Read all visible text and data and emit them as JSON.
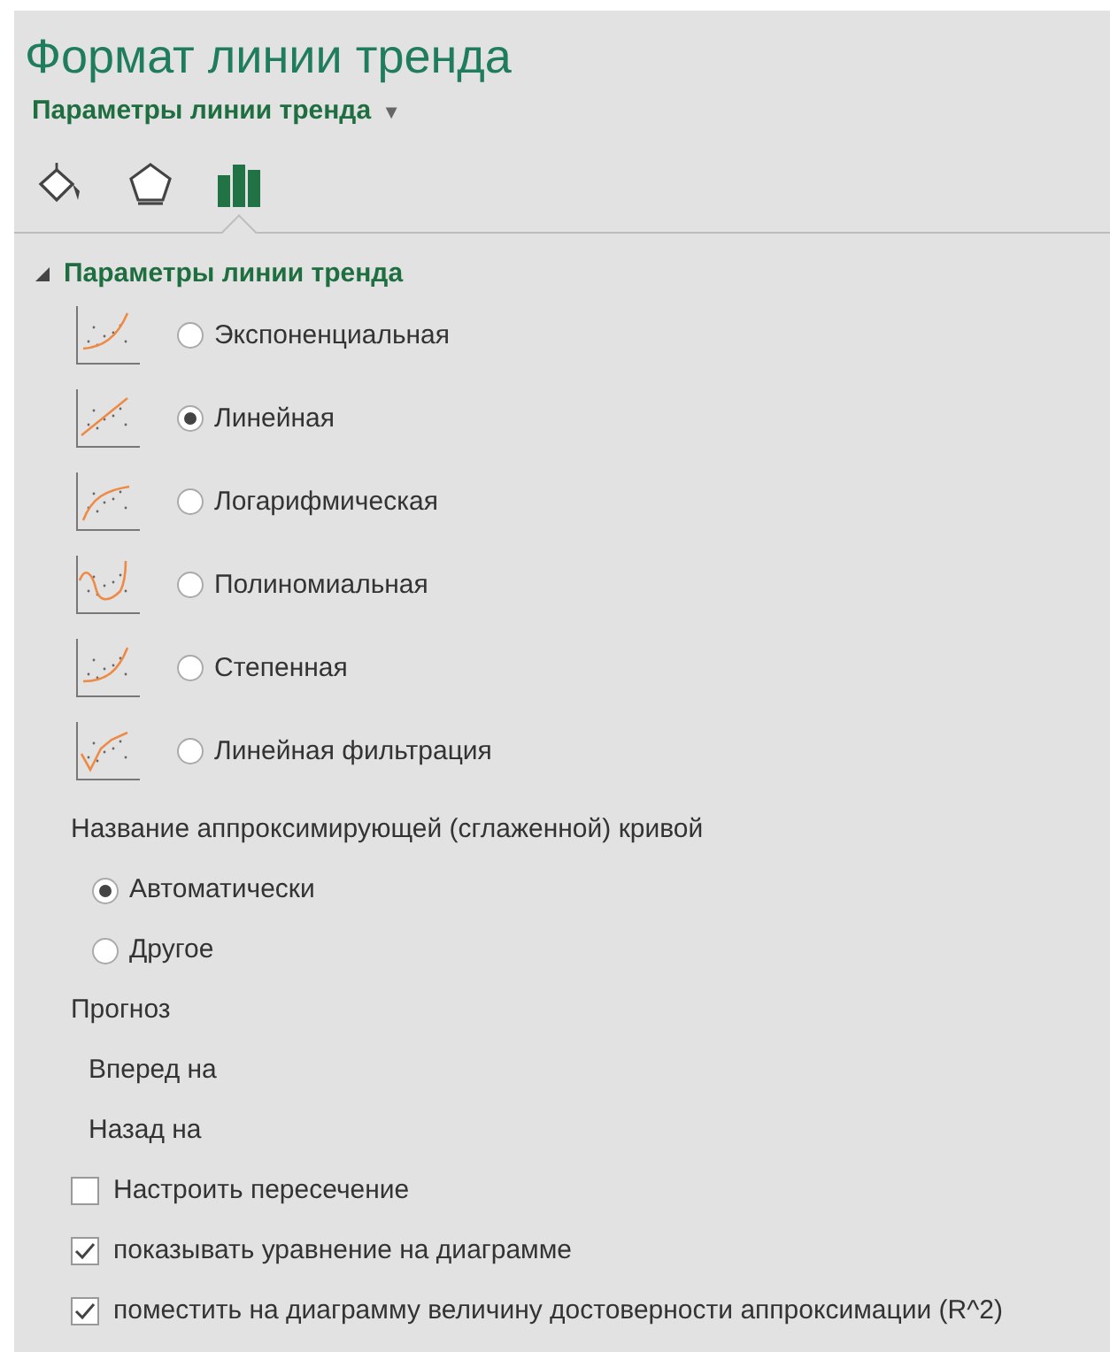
{
  "pane": {
    "title": "Формат линии тренда",
    "subtitle": "Параметры линии тренда",
    "subtitle_caret": "▼"
  },
  "tabs": [
    {
      "kind": "fill",
      "selected": false
    },
    {
      "kind": "effects",
      "selected": false
    },
    {
      "kind": "options",
      "selected": true
    }
  ],
  "section": {
    "title": "Параметры линии тренда",
    "expanded": true
  },
  "trend_types": [
    {
      "kind": "exponential",
      "label": "Экспоненциальная",
      "selected": false
    },
    {
      "kind": "linear",
      "label": "Линейная",
      "selected": true
    },
    {
      "kind": "logarithmic",
      "label": "Логарифмическая",
      "selected": false
    },
    {
      "kind": "polynomial",
      "label": "Полиномиальная",
      "selected": false
    },
    {
      "kind": "power",
      "label": "Степенная",
      "selected": false
    },
    {
      "kind": "moving_average",
      "label": "Линейная фильтрация",
      "selected": false
    }
  ],
  "name_group": {
    "label": "Название аппроксимирующей (сглаженной) кривой",
    "options": [
      {
        "label": "Автоматически",
        "selected": true
      },
      {
        "label": "Другое",
        "selected": false
      }
    ]
  },
  "forecast": {
    "label": "Прогноз",
    "fields": [
      {
        "label": "Вперед на"
      },
      {
        "label": "Назад на"
      }
    ]
  },
  "checkboxes": [
    {
      "label": "Настроить пересечение",
      "checked": false
    },
    {
      "label": "показывать уравнение на диаграмме",
      "checked": true
    },
    {
      "label": "поместить на диаграмму величину достоверности аппроксимации (R^2)",
      "checked": true
    }
  ]
}
